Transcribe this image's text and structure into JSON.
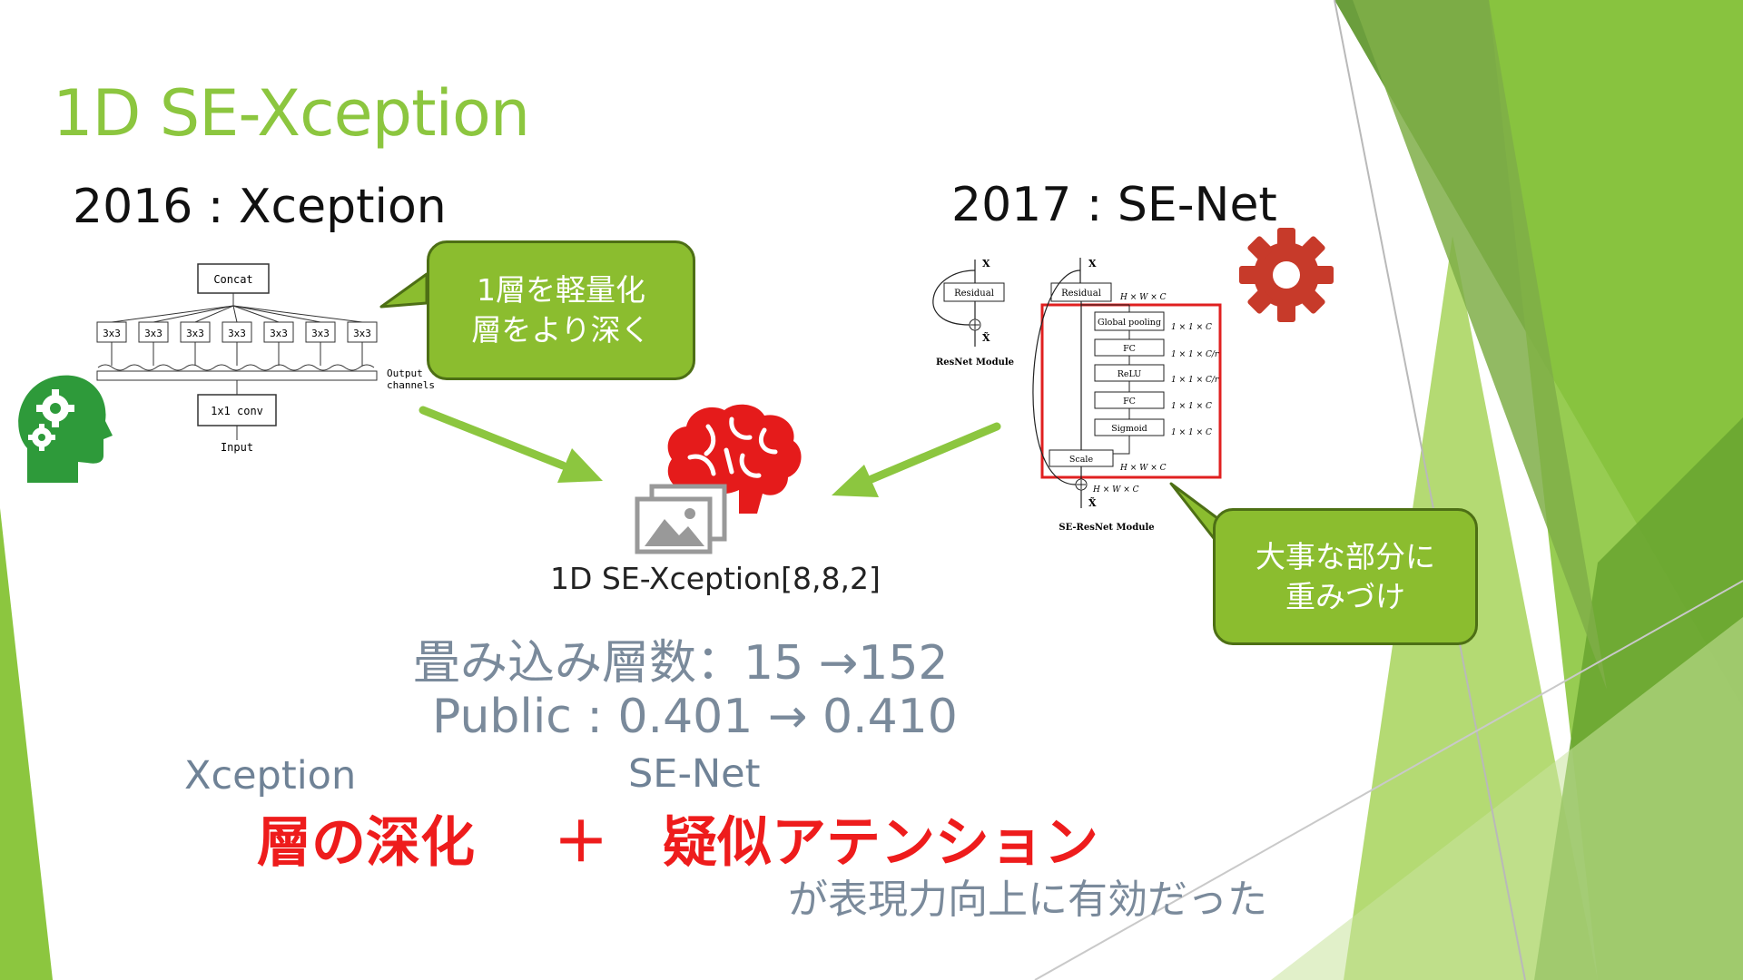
{
  "slide": {
    "title": "1D SE-Xception",
    "left_heading": "2016 : Xception",
    "right_heading": "2017 : SE-Net",
    "center_caption": "1D SE-Xception[8,8,2]",
    "stat_layers": "畳み込み層数：15 →152",
    "stat_public": "Public : 0.401 → 0.410",
    "label_xception": "Xception",
    "label_senet": "SE-Net",
    "emphasis_left": "層の深化",
    "emphasis_plus": "＋",
    "emphasis_right": "疑似アテンション",
    "conclusion": "が表現力向上に有効だった",
    "accent_color": "#8cc63f",
    "emphasis_color": "#ee1c1c"
  },
  "callouts": {
    "left": {
      "line1": "1層を軽量化",
      "line2": "層をより深く"
    },
    "right": {
      "line1": "大事な部分に",
      "line2": "重みづけ"
    }
  },
  "xception_diagram": {
    "concat": "Concat",
    "convs": [
      "3x3",
      "3x3",
      "3x3",
      "3x3",
      "3x3",
      "3x3",
      "3x3"
    ],
    "output_line1": "Output",
    "output_line2": "channels",
    "pointwise": "1x1 conv",
    "input": "Input"
  },
  "senet_diagram": {
    "x_label": "X",
    "x_tilde": "X̃",
    "resnet_residual": "Residual",
    "resnet_caption": "ResNet Module",
    "se_residual": "Residual",
    "global_pooling": "Global pooling",
    "fc1": "FC",
    "relu": "ReLU",
    "fc2": "FC",
    "sigmoid": "Sigmoid",
    "scale": "Scale",
    "dims": {
      "hwc_top": "H × W × C",
      "gp": "1 × 1 × C",
      "fc1": "1 × 1 × C/r",
      "relu": "1 × 1 × C/r",
      "fc2": "1 × 1 × C",
      "sigmoid": "1 × 1 × C",
      "scale": "H × W × C",
      "out": "H × W × C"
    },
    "se_caption": "SE-ResNet Module"
  },
  "icons": [
    "head-gears-icon",
    "gear-icon",
    "brain-icon",
    "image-gallery-icon",
    "arrow-icon"
  ]
}
